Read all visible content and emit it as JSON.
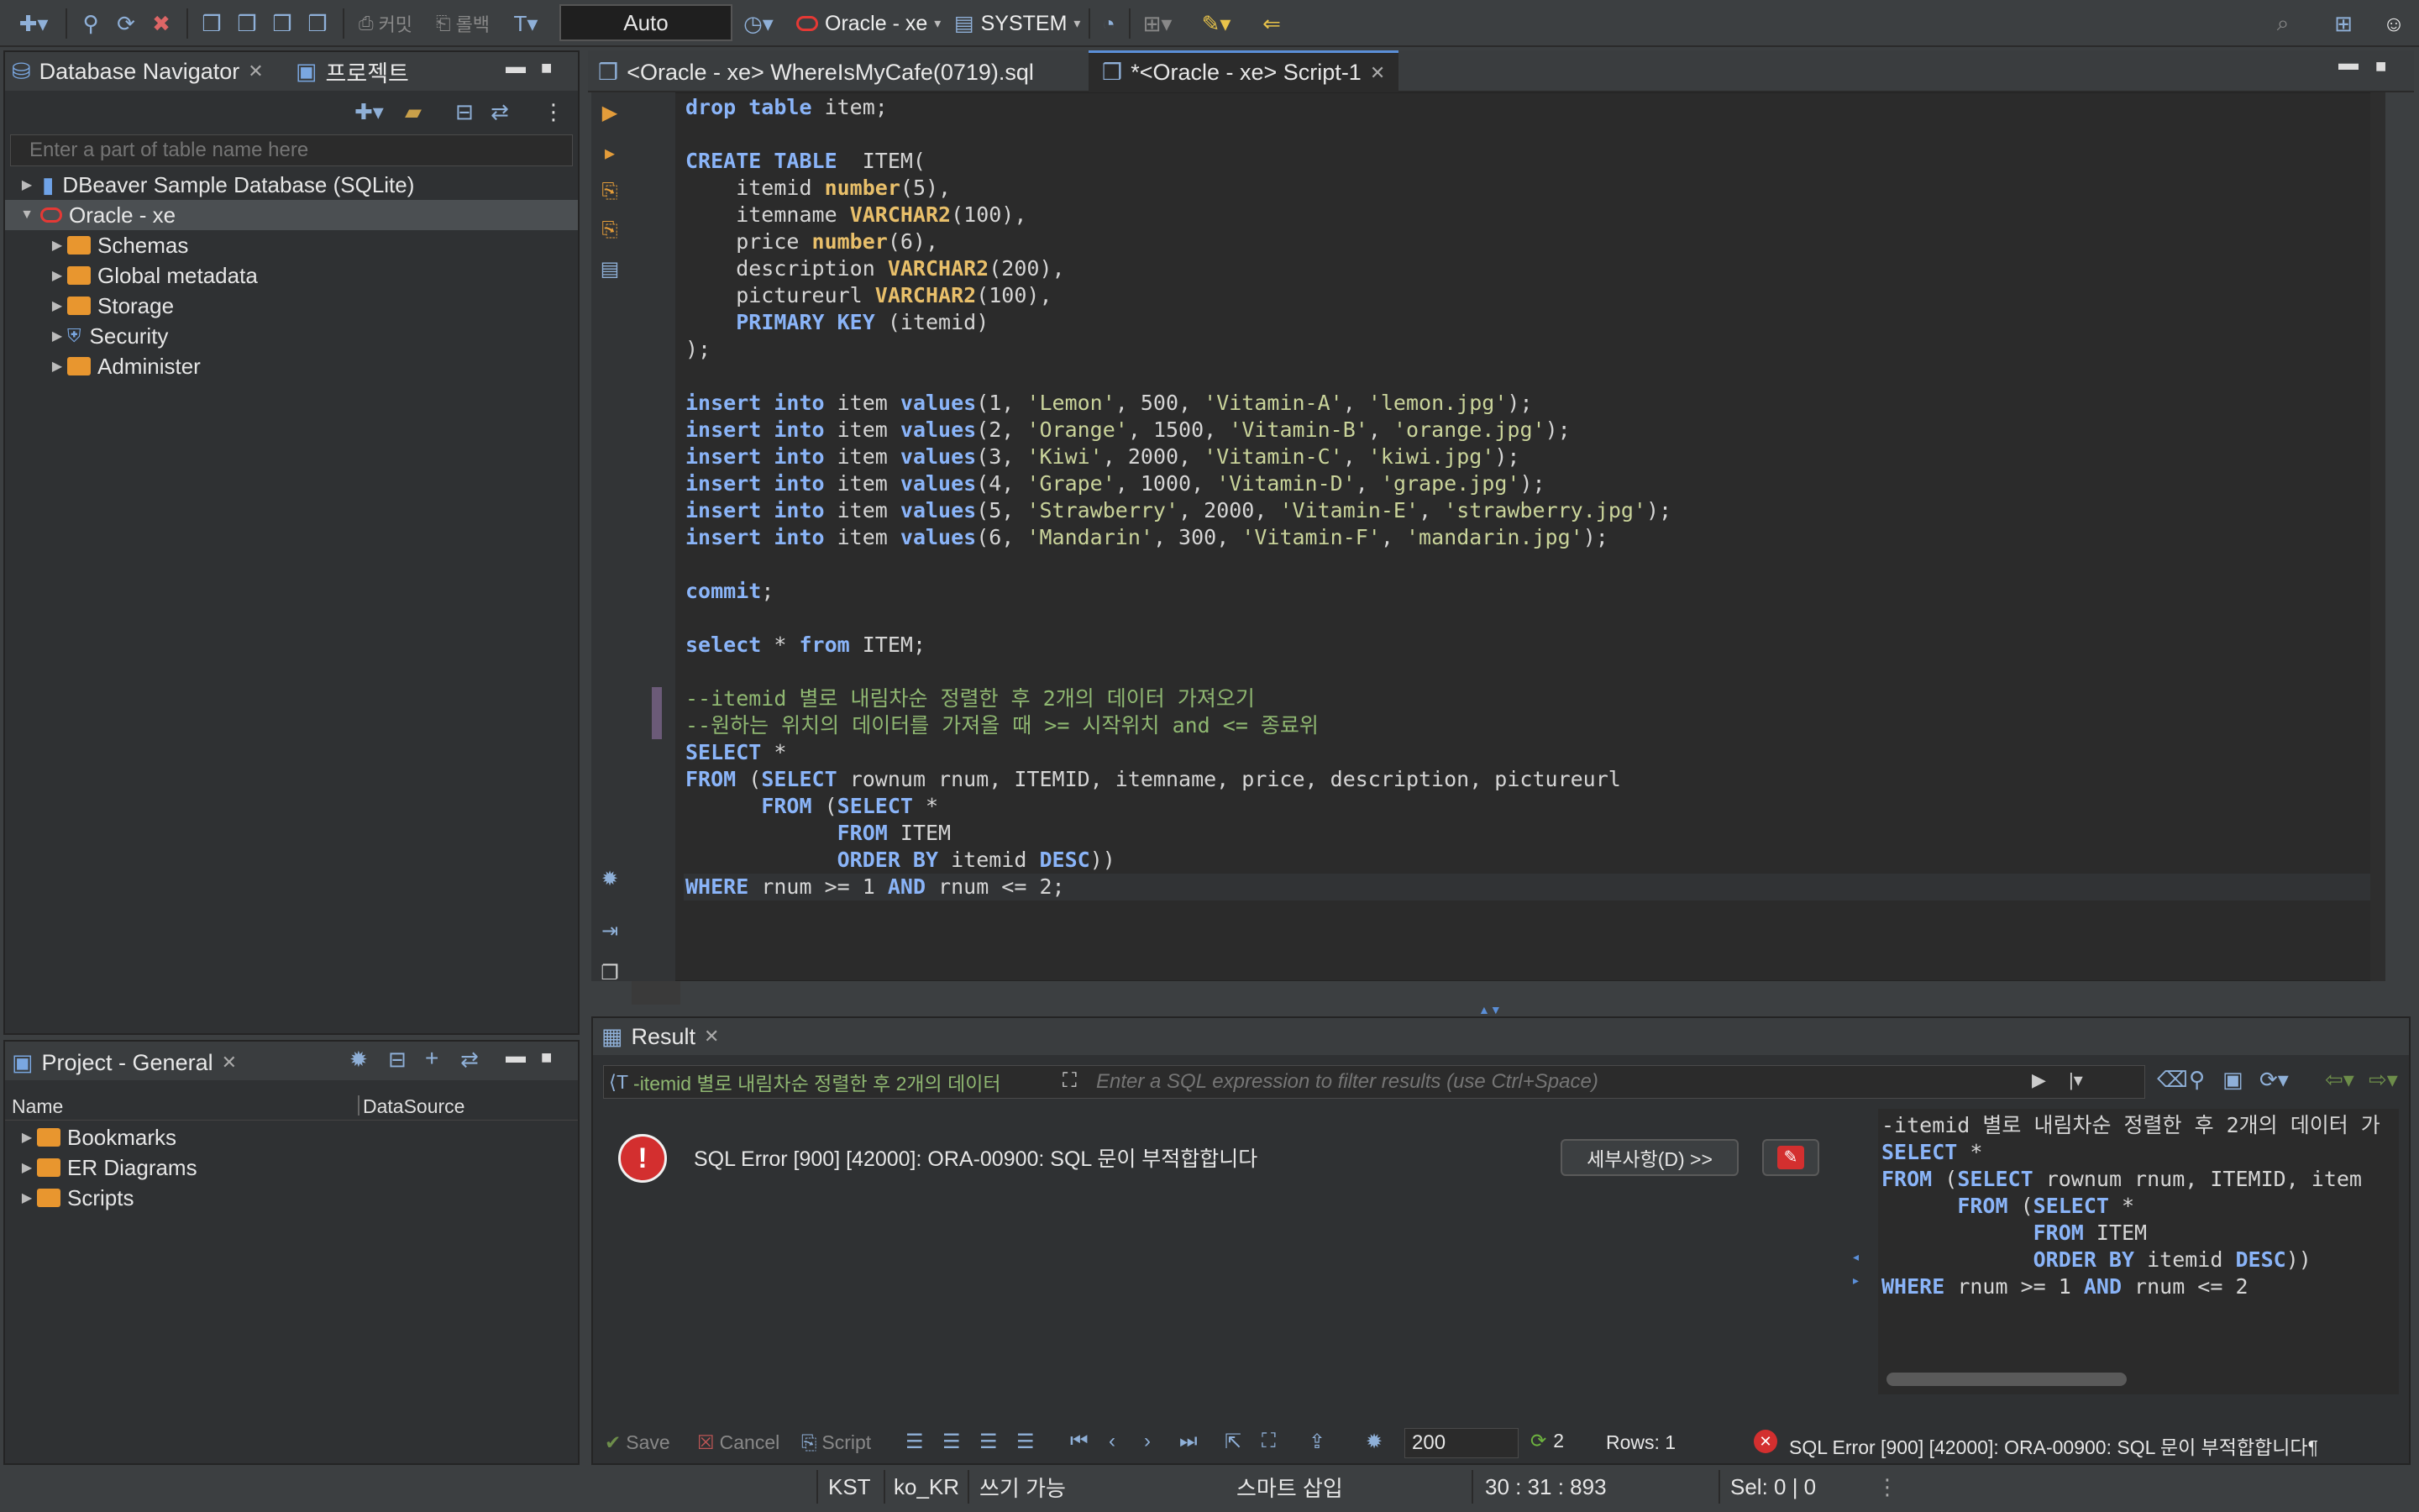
{
  "toolbar": {
    "commit_label": "커밋",
    "rollback_label": "롤백",
    "mode_value": "Auto",
    "connection_label": "Oracle - xe",
    "schema_label": "SYSTEM"
  },
  "navigator": {
    "tab_label": "Database Navigator",
    "projects_tab_label": "프로젝트",
    "filter_placeholder": "Enter a part of table name here",
    "items": [
      {
        "label": "DBeaver Sample Database (SQLite)"
      },
      {
        "label": "Oracle - xe"
      },
      {
        "label": "Schemas"
      },
      {
        "label": "Global metadata"
      },
      {
        "label": "Storage"
      },
      {
        "label": "Security"
      },
      {
        "label": "Administer"
      }
    ]
  },
  "project": {
    "tab_label": "Project - General",
    "columns": [
      "Name",
      "DataSource"
    ],
    "items": [
      {
        "label": "Bookmarks"
      },
      {
        "label": "ER Diagrams"
      },
      {
        "label": "Scripts"
      }
    ]
  },
  "editor": {
    "tabs": [
      {
        "label": "<Oracle - xe> WhereIsMyCafe(0719).sql"
      },
      {
        "label": "*<Oracle - xe> Script-1"
      }
    ]
  },
  "result": {
    "tab_label": "Result",
    "query_chip": "-itemid 별로 내림차순 정렬한 후 2개의 데이터",
    "filter_placeholder": "Enter a SQL expression to filter results (use Ctrl+Space)",
    "error_message": "SQL Error [900] [42000]: ORA-00900: SQL 문이 부적합합니다",
    "details_button": "세부사항(D) >>",
    "side_sql_first": "-itemid 별로 내림차순 정렬한 후 2개의 데이터 가",
    "bottom": {
      "save": "Save",
      "cancel": "Cancel",
      "script": "Script",
      "fetch_size": "200",
      "refresh_count": "2",
      "rows": "Rows: 1",
      "status_error": "SQL Error [900] [42000]: ORA-00900: SQL 문이 부적합합니다¶"
    }
  },
  "statusbar": {
    "timezone": "KST",
    "locale": "ko_KR",
    "writable": "쓰기 가능",
    "insert_mode": "스마트 삽입",
    "position": "30 : 31 : 893",
    "selection": "Sel: 0 | 0"
  },
  "colors": {
    "background": "#3c3f41",
    "panel": "#2f3133",
    "editor_bg": "#2b2b2b",
    "keyword": "#8ab4f8",
    "type": "#e8bf6a",
    "string": "#c9d39a",
    "comment": "#8fb771",
    "error": "#d32f2f"
  }
}
